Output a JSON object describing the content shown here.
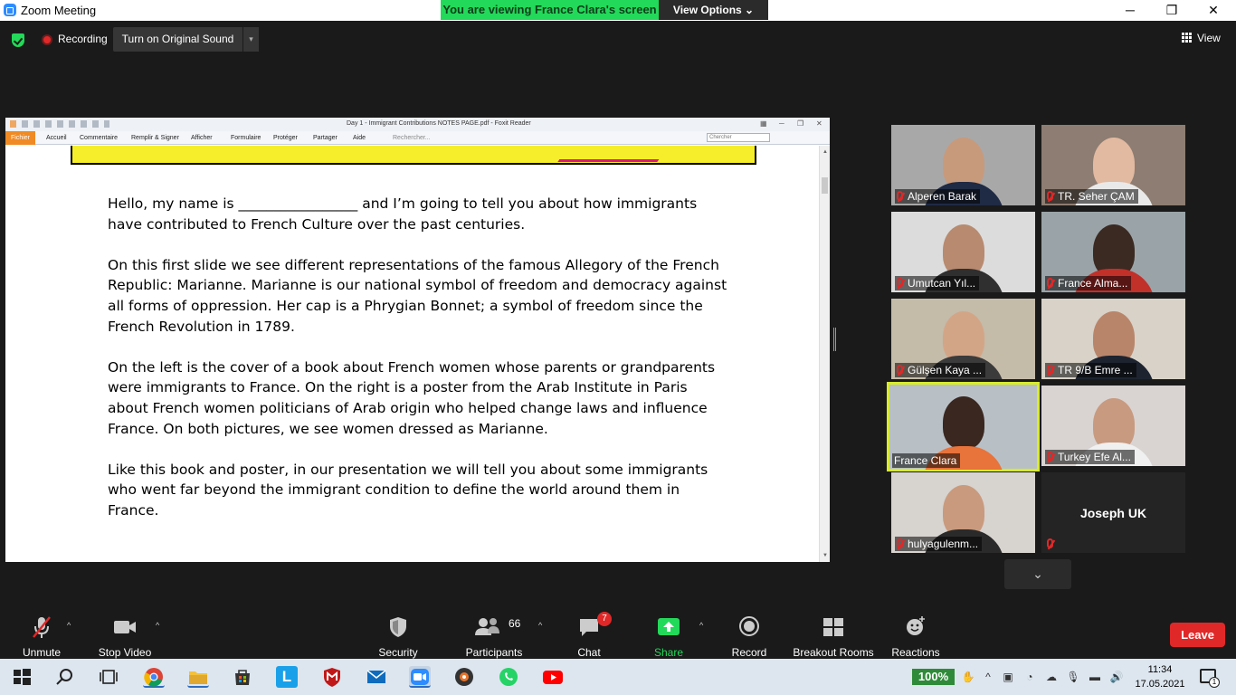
{
  "window": {
    "title": "Zoom Meeting",
    "minimize": "─",
    "restore": "❐",
    "close": "✕"
  },
  "banner": {
    "viewing": "You are viewing France Clara's screen",
    "view_options": "View Options ⌄"
  },
  "topbar": {
    "recording": "Recording",
    "original_sound": "Turn on Original Sound",
    "dropdown": "▾",
    "view": "View"
  },
  "foxit": {
    "title": "Day 1 - Immigrant Contributions NOTES PAGE.pdf - Foxit Reader",
    "menu": [
      "Fichier",
      "Accueil",
      "Commentaire",
      "Remplir & Signer",
      "Afficher",
      "Formulaire",
      "Protéger",
      "Partager",
      "Aide",
      "Rechercher..."
    ],
    "search_placeholder": "Chercher",
    "paragraphs": [
      "Hello, my name is _________________ and I’m going to tell you about how immigrants have contributed to French Culture over the past centuries.",
      "On this first slide we see different representations of the famous Allegory of the French Republic: Marianne. Marianne is our national symbol of freedom and democracy against all forms of oppression.  Her cap is a Phrygian Bonnet; a symbol of freedom since the French Revolution in 1789.",
      "On the left is the cover of a book about French women whose parents or grandparents were immigrants to France. On the right is a poster from the Arab Institute in Paris about French women politicians of Arab origin who helped change laws and influence France. On both pictures, we see women dressed as Marianne.",
      "Like this book and poster, in our presentation we will tell you about some immigrants who went far beyond the immigrant condition to define the world around them in France."
    ]
  },
  "participants_grid": [
    {
      "name": "Alperen Barak",
      "bg": "#a8a8a8",
      "skin": "#c79a7c",
      "shirt": "#1f2a44"
    },
    {
      "name": "TR. Seher ÇAM",
      "bg": "#8d7d72",
      "skin": "#e2b9a1",
      "shirt": "#e9e9e9"
    },
    {
      "name": "Umutcan Yıl...",
      "bg": "#dcdcdc",
      "skin": "#b88a6f",
      "shirt": "#2f2f2f"
    },
    {
      "name": "France Alma...",
      "bg": "#9aa4a8",
      "skin": "#3b2a22",
      "shirt": "#c2302a"
    },
    {
      "name": "Gülşen Kaya ...",
      "bg": "#c4bba9",
      "skin": "#d3a587",
      "shirt": "#3b3b3b"
    },
    {
      "name": "TR 9/B Emre ...",
      "bg": "#d8d2c8",
      "skin": "#b9856a",
      "shirt": "#1d2430"
    },
    {
      "name": "France Clara",
      "bg": "#b8c0c6",
      "skin": "#3a2720",
      "shirt": "#e8733b"
    },
    {
      "name": "Turkey Efe Al...",
      "bg": "#d9d4d2",
      "skin": "#c89a80",
      "shirt": "#f0f0f0"
    },
    {
      "name": "hulyagulenm...",
      "bg": "#d7d3cf",
      "skin": "#c99a7d",
      "shirt": "#2a2a2a"
    },
    {
      "name": "Joseph UK",
      "bg": "#242424",
      "skin": "",
      "shirt": ""
    }
  ],
  "toolbar": {
    "unmute": "Unmute",
    "stop_video": "Stop Video",
    "security": "Security",
    "participants": "Participants",
    "participants_count": "66",
    "chat": "Chat",
    "chat_badge": "7",
    "share_screen": "Share Screen",
    "record": "Record",
    "breakout_rooms": "Breakout Rooms",
    "reactions": "Reactions",
    "leave": "Leave"
  },
  "taskbar": {
    "battery": "100%",
    "time": "11:34",
    "date": "17.05.2021",
    "notifications": "1"
  },
  "colors": {
    "accent": "#23d959",
    "danger": "#e02828",
    "active_speaker": "#d8ec2a"
  }
}
